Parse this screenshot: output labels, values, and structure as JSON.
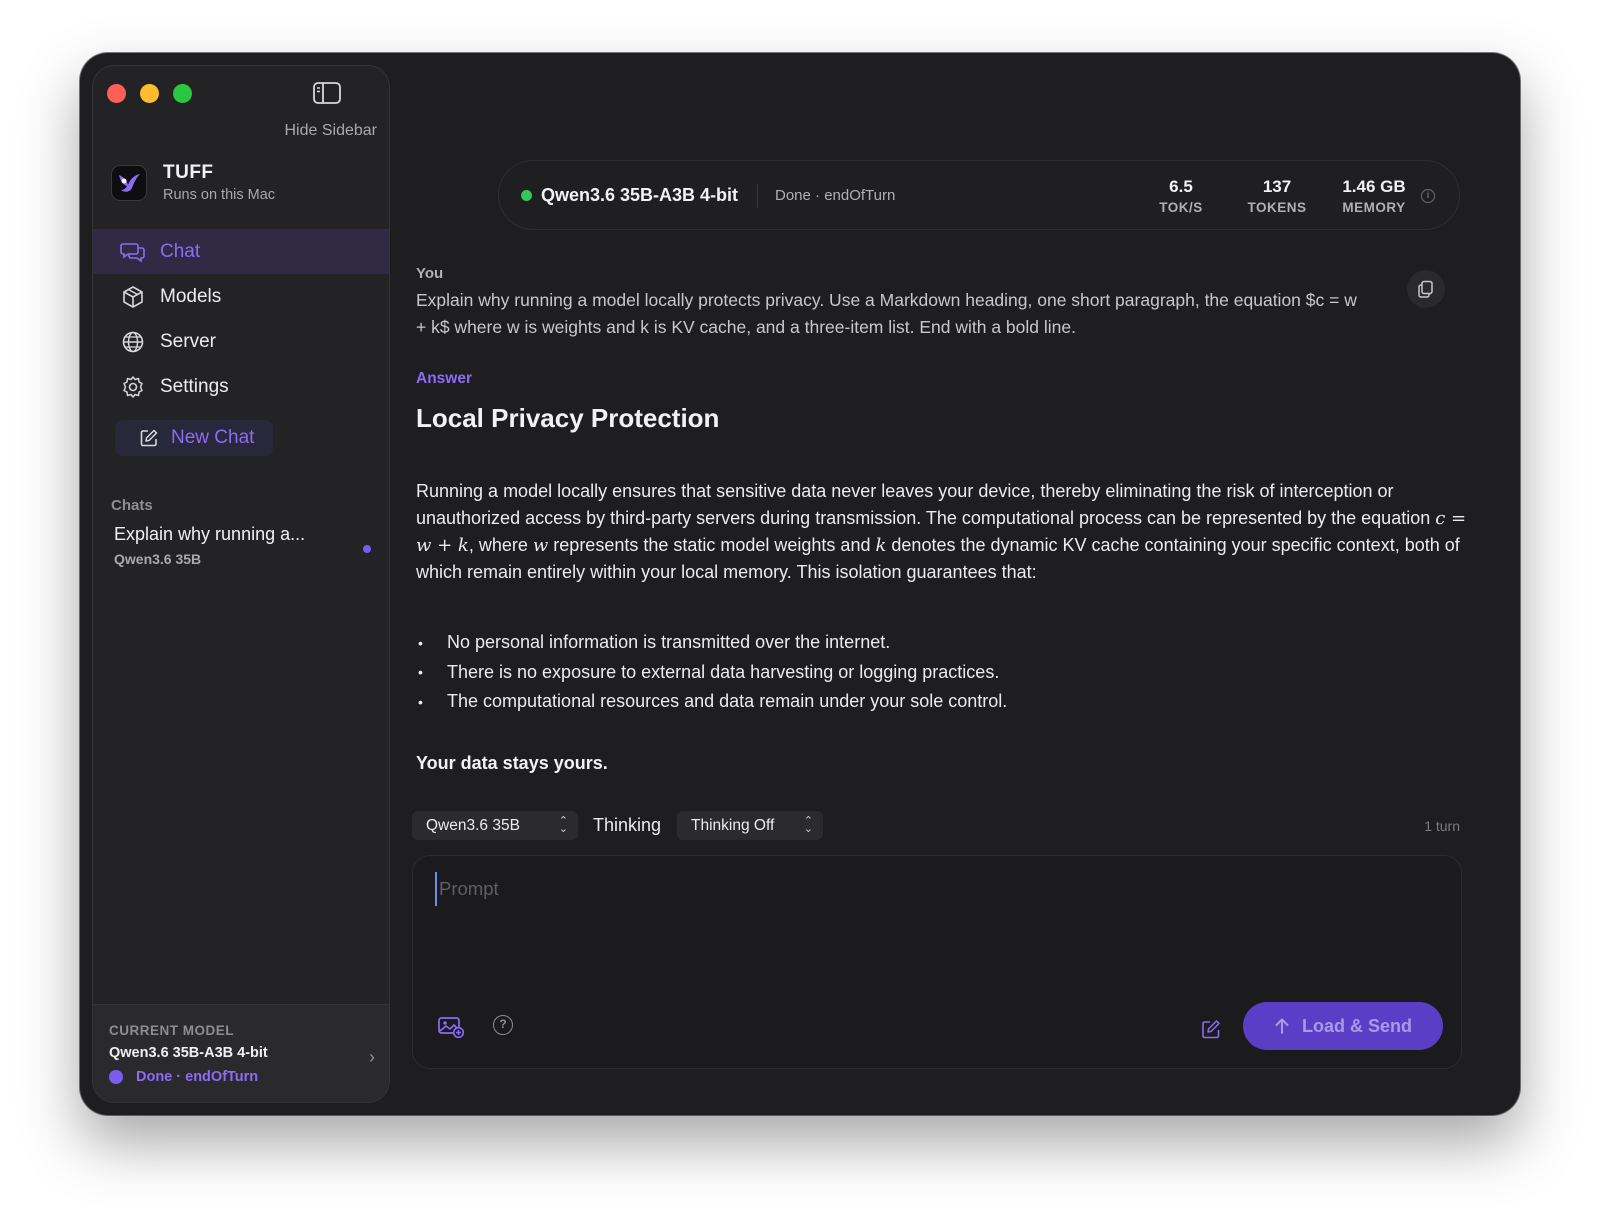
{
  "sidebar": {
    "hide_label": "Hide Sidebar",
    "brand_name": "TUFF",
    "brand_sub": "Runs on this Mac",
    "nav": [
      {
        "label": "Chat",
        "icon": "chat-bubbles-icon",
        "active": true
      },
      {
        "label": "Models",
        "icon": "cube-icon",
        "active": false
      },
      {
        "label": "Server",
        "icon": "globe-icon",
        "active": false
      },
      {
        "label": "Settings",
        "icon": "gear-icon",
        "active": false
      }
    ],
    "new_chat": "New Chat",
    "chats_label": "Chats",
    "chats": [
      {
        "title": "Explain why running a...",
        "model": "Qwen3.6 35B",
        "unread": true
      }
    ],
    "current_model": {
      "label": "CURRENT MODEL",
      "name": "Qwen3.6 35B-A3B 4-bit",
      "status": "Done · endOfTurn"
    }
  },
  "statusbar": {
    "model": "Qwen3.6 35B-A3B 4-bit",
    "status": "Done · endOfTurn",
    "metrics": [
      {
        "value": "6.5",
        "label": "TOK/S"
      },
      {
        "value": "137",
        "label": "TOKENS"
      },
      {
        "value": "1.46 GB",
        "label": "MEMORY"
      }
    ]
  },
  "conversation": {
    "you_label": "You",
    "you_text_line1": "Explain why running a model locally protects privacy. Use a Markdown heading, one short paragraph, the equation $c = w",
    "you_text_line2": "+ k$ where w is weights and k is KV cache, and a three-item list. End with a bold line.",
    "answer_label": "Answer",
    "heading": "Local Privacy Protection",
    "paragraph": {
      "p1": "Running a model locally ensures that sensitive data never leaves your device, thereby eliminating the risk of interception or unauthorized access by third-party servers during transmission. The computational process can be represented by the equation ",
      "eq": "c = w + k",
      "p2": ", where ",
      "w": "w",
      "p3": " represents the static model weights and ",
      "k": "k",
      "p4": " denotes the dynamic KV cache containing your specific context, both of which remain entirely within your local memory. This isolation guarantees that:"
    },
    "list": [
      "No personal information is transmitted over the internet.",
      "There is no exposure to external data harvesting or logging practices.",
      "The computational resources and data remain under your sole control."
    ],
    "bold_line": "Your data stays yours."
  },
  "controls": {
    "model_select": "Qwen3.6 35B",
    "thinking_label": "Thinking",
    "thinking_select": "Thinking Off",
    "turns": "1 turn"
  },
  "composer": {
    "placeholder": "Prompt",
    "send_label": "Load & Send"
  },
  "colors": {
    "accent": "#8b6cf7",
    "send_bg": "#5a3fc6",
    "status_green": "#34c759"
  }
}
